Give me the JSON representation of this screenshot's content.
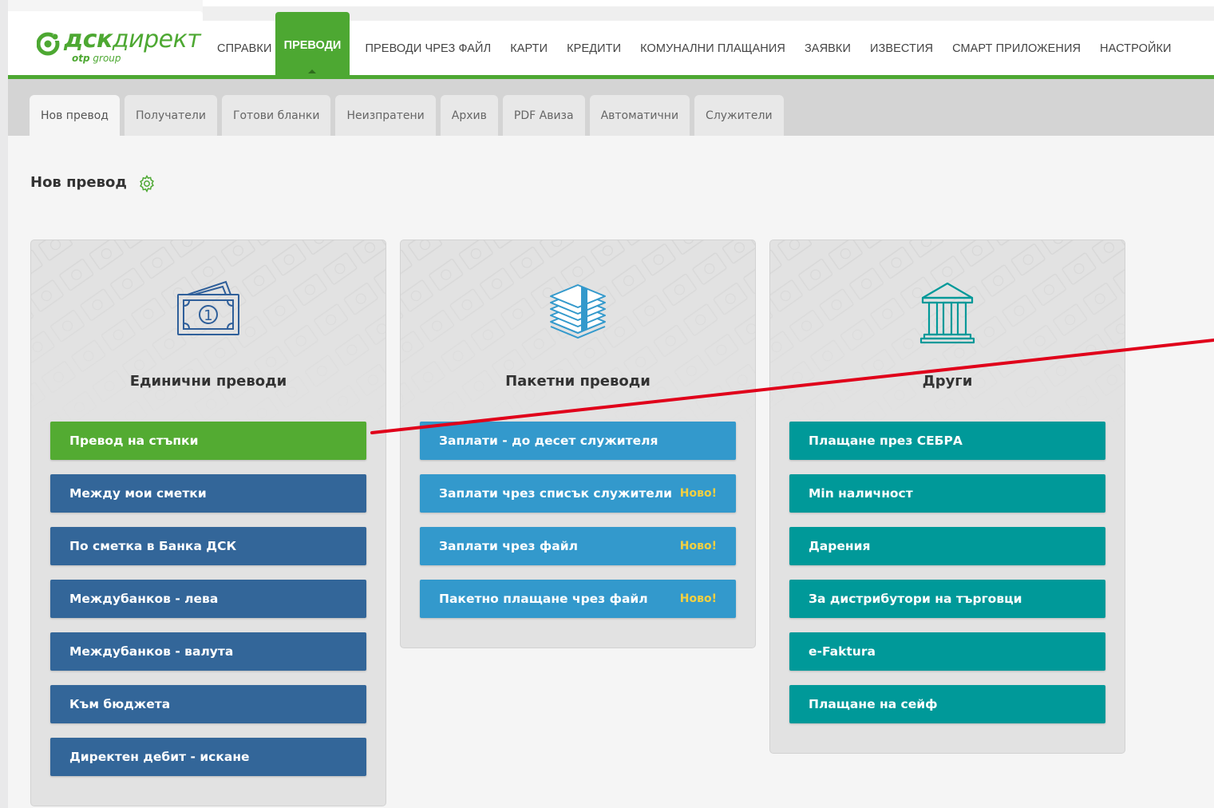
{
  "colors": {
    "brand_green": "#4da832",
    "btn_green": "#53ab32",
    "btn_navy": "#336699",
    "btn_blue": "#3399cc",
    "btn_teal": "#009999",
    "new_badge": "#f4d03f",
    "annotation_red": "#e0001a"
  },
  "logo": {
    "main_bold": "дск",
    "main_thin": "директ",
    "sub_bold": "otp",
    "sub_thin": "group",
    "icon": "dsk-logo-icon"
  },
  "nav": {
    "items_before": [
      "СПРАВКИ"
    ],
    "active": "ПРЕВОДИ",
    "items_after": [
      "ПРЕВОДИ ЧРЕЗ ФАЙЛ",
      "КАРТИ",
      "КРЕДИТИ",
      "КОМУНАЛНИ ПЛАЩАНИЯ",
      "ЗАЯВКИ",
      "ИЗВЕСТИЯ",
      "СМАРТ ПРИЛОЖЕНИЯ",
      "НАСТРОЙКИ"
    ]
  },
  "subtabs": [
    "Нов превод",
    "Получатели",
    "Готови бланки",
    "Неизпратени",
    "Архив",
    "PDF Авиза",
    "Автоматични",
    "Служители"
  ],
  "page": {
    "title": "Нов превод",
    "settings_icon": "gear-icon"
  },
  "cards": [
    {
      "title": "Единични преводи",
      "icon": "banknote-icon",
      "buttons": [
        {
          "label": "Превод на стъпки",
          "color": "green",
          "badge": ""
        },
        {
          "label": "Между мои сметки",
          "color": "navy",
          "badge": ""
        },
        {
          "label": "По сметка в Банка ДСК",
          "color": "navy",
          "badge": ""
        },
        {
          "label": "Междубанков - лева",
          "color": "navy",
          "badge": ""
        },
        {
          "label": "Междубанков - валута",
          "color": "navy",
          "badge": ""
        },
        {
          "label": "Към бюджета",
          "color": "navy",
          "badge": ""
        },
        {
          "label": "Директен дебит - искане",
          "color": "navy",
          "badge": ""
        }
      ]
    },
    {
      "title": "Пакетни преводи",
      "icon": "money-stack-icon",
      "buttons": [
        {
          "label": "Заплати - до десет служителя",
          "color": "blue",
          "badge": ""
        },
        {
          "label": "Заплати чрез списък служители",
          "color": "blue",
          "badge": "Ново!"
        },
        {
          "label": "Заплати чрез файл",
          "color": "blue",
          "badge": "Ново!"
        },
        {
          "label": "Пакетно плащане чрез файл",
          "color": "blue",
          "badge": "Ново!"
        }
      ]
    },
    {
      "title": "Други",
      "icon": "bank-building-icon",
      "buttons": [
        {
          "label": "Плащане през СЕБРА",
          "color": "teal",
          "badge": ""
        },
        {
          "label": "Min наличност",
          "color": "teal",
          "badge": ""
        },
        {
          "label": "Дарения",
          "color": "teal",
          "badge": ""
        },
        {
          "label": "За дистрибутори на търговци",
          "color": "teal",
          "badge": ""
        },
        {
          "label": "e-Faktura",
          "color": "teal",
          "badge": ""
        },
        {
          "label": "Плащане на сейф",
          "color": "teal",
          "badge": ""
        }
      ]
    }
  ]
}
